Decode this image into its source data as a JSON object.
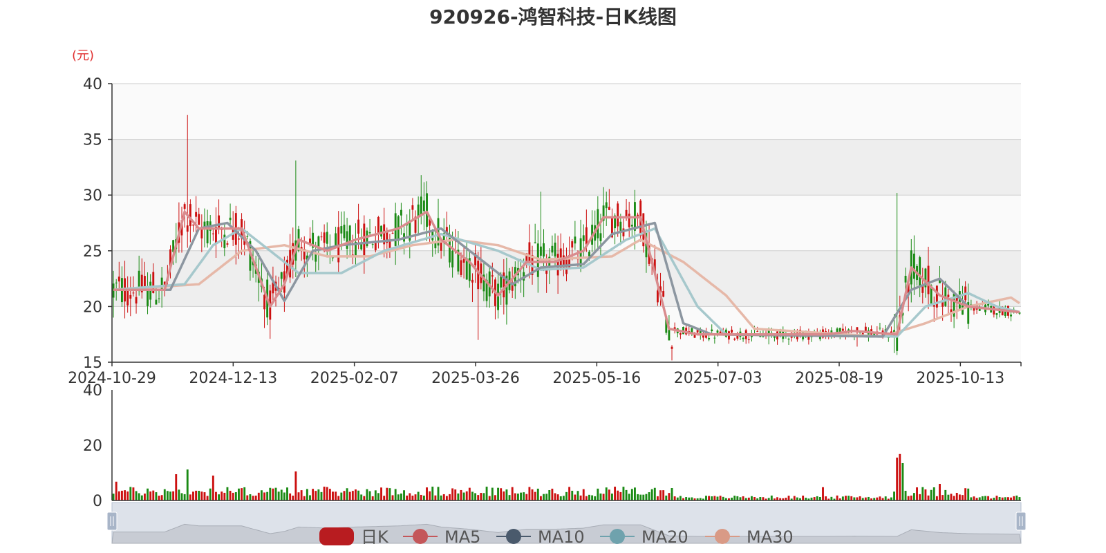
{
  "chart_data": [
    {
      "type": "candlestick",
      "title": "920926-鸿智科技-日K线图",
      "ylabel": "(元)",
      "ylim": [
        15,
        40
      ],
      "yticks": [
        "15",
        "20",
        "25",
        "30",
        "35",
        "40"
      ],
      "xticks": [
        "2024-10-29",
        "2024-12-13",
        "2025-02-07",
        "2025-03-26",
        "2025-05-16",
        "2025-07-03",
        "2025-08-19",
        "2025-10-13"
      ],
      "grid": true,
      "legend_position": "bottom-center",
      "ma_series_approx": {
        "MA5": [
          [
            0,
            21.5
          ],
          [
            18,
            21.5
          ],
          [
            25,
            28.5
          ],
          [
            30,
            27
          ],
          [
            45,
            27
          ],
          [
            55,
            20
          ],
          [
            60,
            22
          ],
          [
            65,
            26
          ],
          [
            75,
            25
          ],
          [
            85,
            26
          ],
          [
            100,
            27
          ],
          [
            110,
            28.5
          ],
          [
            115,
            26
          ],
          [
            125,
            24
          ],
          [
            135,
            21
          ],
          [
            145,
            24
          ],
          [
            155,
            24
          ],
          [
            165,
            25
          ],
          [
            172,
            28
          ],
          [
            185,
            28
          ],
          [
            195,
            18
          ],
          [
            205,
            17.5
          ],
          [
            220,
            17.5
          ],
          [
            250,
            17.5
          ],
          [
            260,
            17.8
          ],
          [
            275,
            17.5
          ],
          [
            280,
            23.5
          ],
          [
            290,
            21
          ],
          [
            300,
            20
          ],
          [
            318,
            19.5
          ]
        ],
        "MA10": [
          [
            0,
            21.5
          ],
          [
            20,
            21.5
          ],
          [
            30,
            27
          ],
          [
            40,
            27.5
          ],
          [
            50,
            25
          ],
          [
            60,
            20.5
          ],
          [
            70,
            25
          ],
          [
            80,
            25.5
          ],
          [
            100,
            26
          ],
          [
            115,
            27
          ],
          [
            130,
            24
          ],
          [
            140,
            22
          ],
          [
            150,
            23.5
          ],
          [
            165,
            23.8
          ],
          [
            175,
            26.5
          ],
          [
            190,
            27.5
          ],
          [
            200,
            18.5
          ],
          [
            210,
            17.5
          ],
          [
            270,
            17.3
          ],
          [
            280,
            21.5
          ],
          [
            290,
            22.5
          ],
          [
            300,
            20
          ],
          [
            318,
            19.5
          ]
        ],
        "MA20": [
          [
            0,
            21.5
          ],
          [
            25,
            22
          ],
          [
            35,
            25.5
          ],
          [
            45,
            27
          ],
          [
            55,
            25
          ],
          [
            65,
            23
          ],
          [
            80,
            23
          ],
          [
            95,
            25
          ],
          [
            115,
            26.5
          ],
          [
            135,
            25
          ],
          [
            150,
            23.3
          ],
          [
            165,
            23.5
          ],
          [
            180,
            26
          ],
          [
            190,
            27
          ],
          [
            205,
            20
          ],
          [
            215,
            17.5
          ],
          [
            275,
            17.3
          ],
          [
            285,
            20
          ],
          [
            300,
            21.2
          ],
          [
            310,
            20
          ],
          [
            318,
            19.5
          ]
        ],
        "MA30": [
          [
            0,
            21.5
          ],
          [
            30,
            22
          ],
          [
            45,
            25
          ],
          [
            60,
            25.5
          ],
          [
            75,
            24.5
          ],
          [
            90,
            24.5
          ],
          [
            105,
            25.5
          ],
          [
            120,
            26
          ],
          [
            135,
            25.5
          ],
          [
            150,
            24.2
          ],
          [
            175,
            24.5
          ],
          [
            185,
            26
          ],
          [
            200,
            24
          ],
          [
            215,
            21
          ],
          [
            225,
            18
          ],
          [
            270,
            17.3
          ],
          [
            285,
            18.5
          ],
          [
            300,
            20
          ],
          [
            315,
            20.8
          ],
          [
            318,
            20.3
          ]
        ]
      },
      "spikes": [
        [
          26,
          37.2
        ],
        [
          64,
          33.1
        ],
        [
          108,
          31.8
        ],
        [
          150,
          30.3
        ],
        [
          275,
          30.2
        ]
      ],
      "drops": [
        [
          128,
          17
        ],
        [
          230,
          16.6
        ],
        [
          261,
          16.4
        ]
      ]
    },
    {
      "type": "bar",
      "ylim": [
        0,
        40
      ],
      "yticks": [
        "0",
        "20",
        "40"
      ],
      "volume_spikes": [
        [
          1,
          6.8
        ],
        [
          22,
          9.5
        ],
        [
          26,
          11.2
        ],
        [
          35,
          9
        ],
        [
          64,
          10.5
        ],
        [
          112,
          5
        ],
        [
          196,
          4.5
        ],
        [
          249,
          4.8
        ],
        [
          275,
          15.5
        ],
        [
          276,
          16.8
        ],
        [
          277,
          13.5
        ],
        [
          290,
          6
        ]
      ]
    }
  ],
  "legend": {
    "items": [
      {
        "label": "日K",
        "color": "#b81c20"
      },
      {
        "label": "MA5",
        "color": "#c4575a"
      },
      {
        "label": "MA10",
        "color": "#4a5a6c"
      },
      {
        "label": "MA20",
        "color": "#6fa2ad"
      },
      {
        "label": "MA30",
        "color": "#d99a86"
      }
    ]
  },
  "colors": {
    "up": "#cc1010",
    "down": "#1a8a14",
    "band_dark": "#eeeeee",
    "band_light": "#fafafa",
    "slider_fill": "#dde2ea"
  }
}
